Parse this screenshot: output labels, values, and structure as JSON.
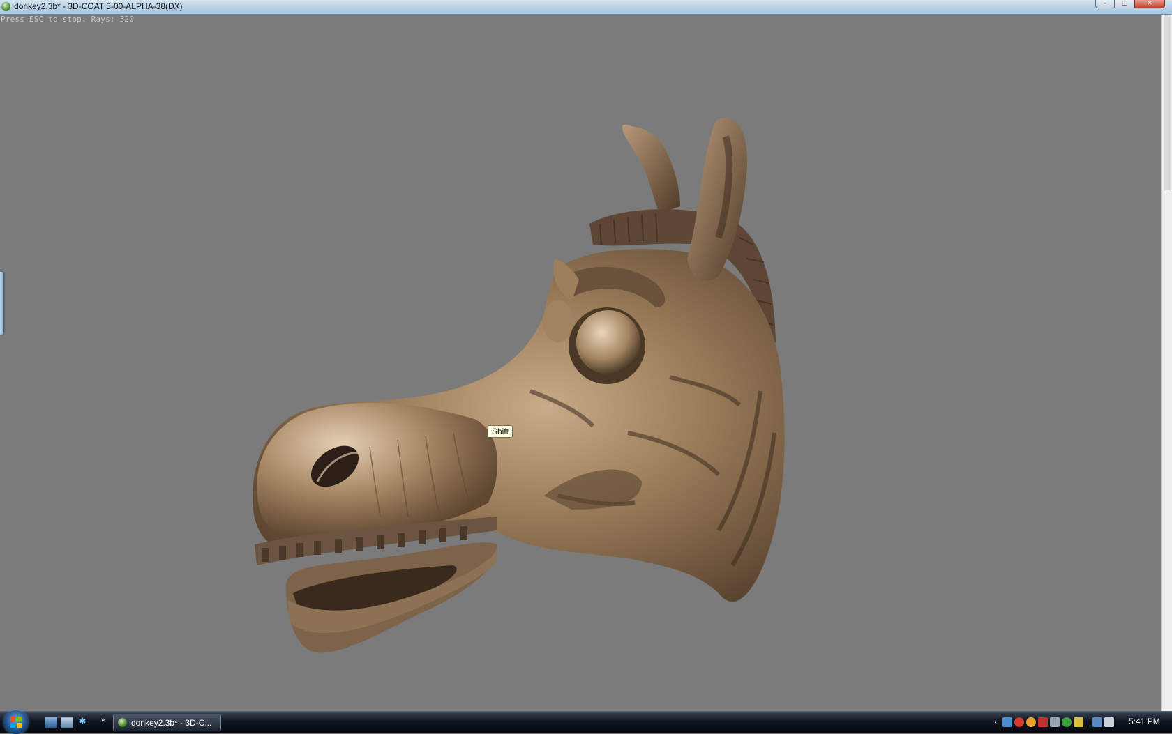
{
  "window": {
    "title": "donkey2.3b* - 3D-COAT 3-00-ALPHA-38(DX)",
    "controls": {
      "minimize": "–",
      "maximize": "□",
      "close": "✕"
    }
  },
  "viewport": {
    "status_text": "Press ESC to stop. Rays: 320",
    "tooltip": "Shift",
    "background_color": "#7c7b7c",
    "model_color": "#8a6f50"
  },
  "taskbar": {
    "start_icon": "windows-logo-icon",
    "quicklaunch": [
      "show-desktop-icon",
      "switch-windows-icon",
      "app-icon"
    ],
    "quicklaunch_more": "»",
    "task_button_label": "donkey2.3b* - 3D-C...",
    "tray_chevron": "‹",
    "tray_icons": [
      "network-icon",
      "security-icon",
      "messenger-icon",
      "antivirus-icon",
      "display-icon",
      "update-icon",
      "notification-icon",
      "connection-icon",
      "volume-icon"
    ],
    "clock": "5:41 PM"
  }
}
